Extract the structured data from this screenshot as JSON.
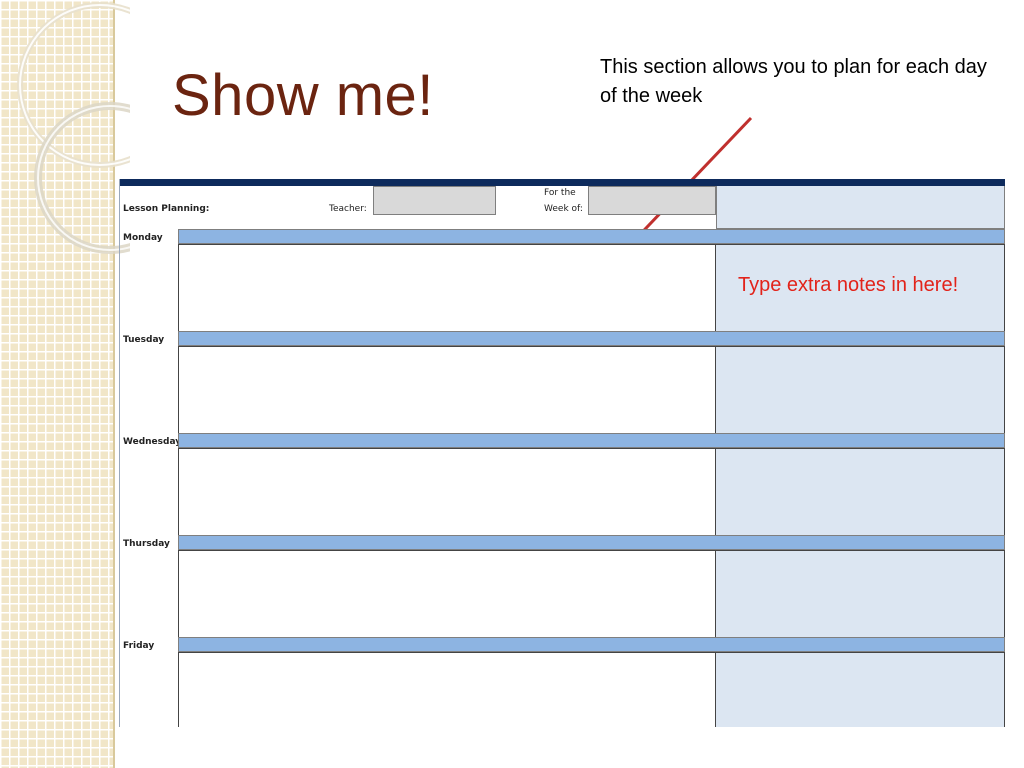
{
  "slide": {
    "title": "Show me!",
    "callout_top": "This section allows you to plan for each day of the week",
    "callout_notes": "Type extra notes in here!"
  },
  "colors": {
    "title": "#6b2410",
    "callout_notes": "#e2231a",
    "arrow": "#c0302e",
    "header_bar": "#0d2a5c",
    "day_bar": "#8db4e2",
    "notes_fill": "#dce6f2",
    "input_fill": "#d9d9d9"
  },
  "sheet": {
    "lesson_planning_label": "Lesson Planning:",
    "teacher_label": "Teacher:",
    "for_the_label": "For the",
    "week_of_label": "Week of:",
    "teacher_value": "",
    "week_of_value": "",
    "days": [
      {
        "label": "Monday"
      },
      {
        "label": "Tuesday"
      },
      {
        "label": "Wednesday"
      },
      {
        "label": "Thursday"
      },
      {
        "label": "Friday"
      }
    ]
  }
}
